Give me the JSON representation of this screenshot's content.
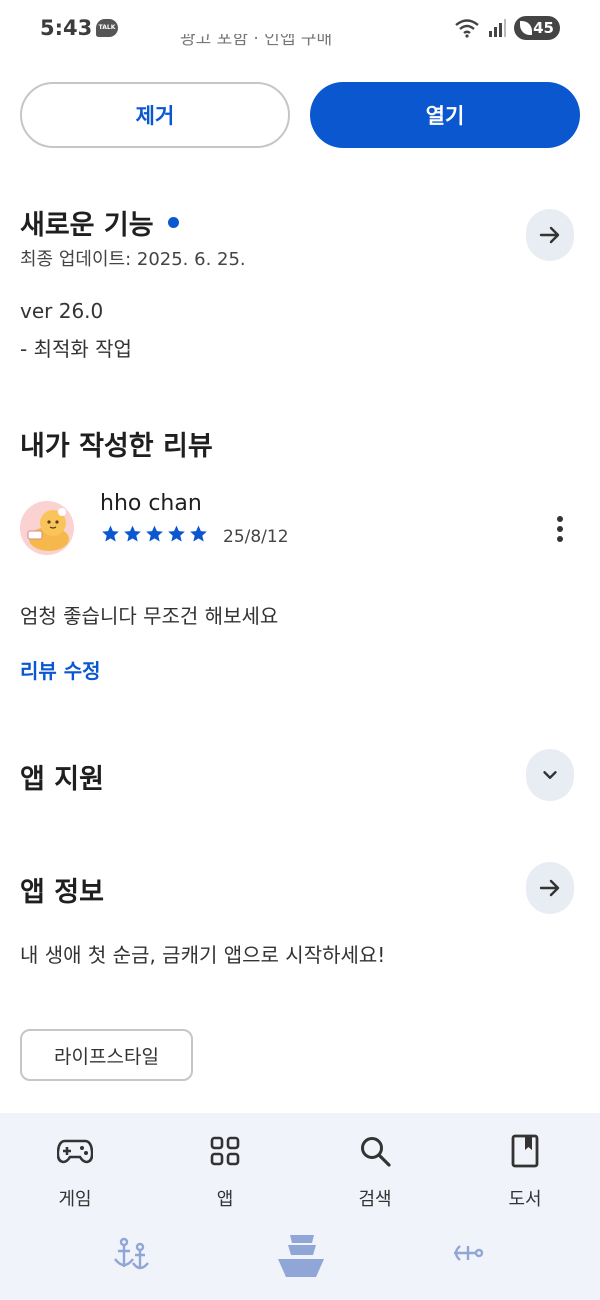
{
  "status_bar": {
    "time": "5:43",
    "talk_badge": "TALK",
    "battery": "45"
  },
  "header": {
    "cut_off_text": "광고 포함 · 인앱 구매"
  },
  "actions": {
    "remove_label": "제거",
    "open_label": "열기"
  },
  "whats_new": {
    "title": "새로운 기능",
    "last_updated": "최종 업데이트: 2025. 6. 25.",
    "version": "ver 26.0",
    "notes": "- 최적화 작업"
  },
  "my_review": {
    "title": "내가 작성한 리뷰",
    "reviewer": "hho chan",
    "rating": 5,
    "date": "25/8/12",
    "text": "엄청 좋습니다 무조건 해보세요",
    "edit_label": "리뷰 수정"
  },
  "app_support": {
    "title": "앱 지원"
  },
  "app_info": {
    "title": "앱 정보",
    "description": "내 생애 첫 순금, 금캐기 앱으로 시작하세요!",
    "category_chip": "라이프스타일"
  },
  "bottom_nav": {
    "items": [
      {
        "label": "게임",
        "icon": "gamepad-icon"
      },
      {
        "label": "앱",
        "icon": "apps-grid-icon"
      },
      {
        "label": "검색",
        "icon": "search-icon"
      },
      {
        "label": "도서",
        "icon": "book-icon"
      }
    ]
  },
  "colors": {
    "accent": "#0b57d0",
    "nav_bg": "#f0f3f9",
    "round_button_bg": "#e8ecf3"
  }
}
